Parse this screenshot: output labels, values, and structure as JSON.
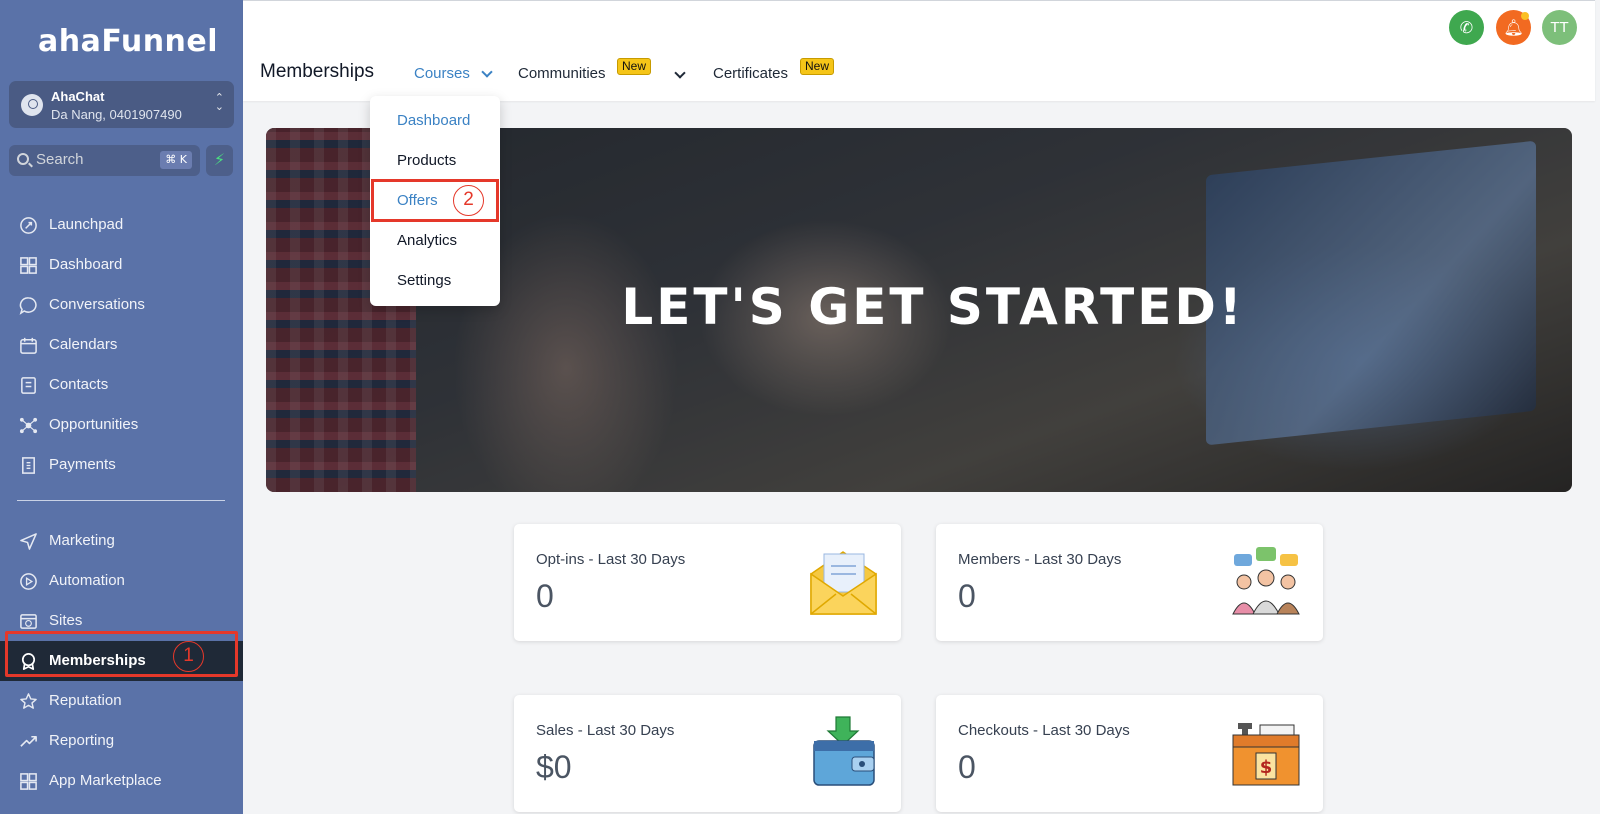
{
  "sidebar": {
    "logo": "ahaFunnel",
    "account": {
      "name": "AhaChat",
      "location": "Da Nang, 0401907490"
    },
    "search": {
      "placeholder": "Search",
      "shortcut": "⌘ K"
    },
    "items": [
      {
        "label": "Launchpad",
        "icon": "rocket-icon"
      },
      {
        "label": "Dashboard",
        "icon": "grid-icon"
      },
      {
        "label": "Conversations",
        "icon": "chat-bubble-icon"
      },
      {
        "label": "Calendars",
        "icon": "calendar-icon"
      },
      {
        "label": "Contacts",
        "icon": "contact-book-icon"
      },
      {
        "label": "Opportunities",
        "icon": "network-icon"
      },
      {
        "label": "Payments",
        "icon": "receipt-icon"
      },
      {
        "label": "Marketing",
        "icon": "send-icon"
      },
      {
        "label": "Automation",
        "icon": "play-circle-icon"
      },
      {
        "label": "Sites",
        "icon": "globe-window-icon"
      },
      {
        "label": "Memberships",
        "icon": "award-icon",
        "active": true
      },
      {
        "label": "Reputation",
        "icon": "star-icon"
      },
      {
        "label": "Reporting",
        "icon": "trend-up-icon"
      },
      {
        "label": "App Marketplace",
        "icon": "apps-grid-icon"
      }
    ]
  },
  "annotations": {
    "step1": "1",
    "step2": "2"
  },
  "header": {
    "title": "Memberships",
    "tabs": [
      {
        "label": "Courses",
        "active": true
      },
      {
        "label": "Communities",
        "badge": "New"
      },
      {
        "label": "Certificates",
        "badge": "New"
      }
    ],
    "avatar_initials": "TT"
  },
  "dropdown": {
    "items": [
      "Dashboard",
      "Products",
      "Offers",
      "Analytics",
      "Settings"
    ]
  },
  "banner": {
    "headline": "LET'S GET STARTED!"
  },
  "stats": [
    {
      "label": "Opt-ins - Last 30 Days",
      "value": "0",
      "icon": "envelope-icon"
    },
    {
      "label": "Members - Last 30 Days",
      "value": "0",
      "icon": "people-chat-icon"
    },
    {
      "label": "Sales - Last 30 Days",
      "value": "$0",
      "icon": "wallet-icon"
    },
    {
      "label": "Checkouts - Last 30 Days",
      "value": "0",
      "icon": "cash-register-icon"
    }
  ],
  "colors": {
    "sidebar_bg": "#5a72a8",
    "active_nav_bg": "#1f2937",
    "accent_blue": "#3b82c4",
    "annotation_red": "#e5382a",
    "badge_yellow": "#f5c518",
    "phone_green": "#3fa84f",
    "bell_orange": "#f26a21",
    "avatar_green": "#7dbf7a"
  }
}
